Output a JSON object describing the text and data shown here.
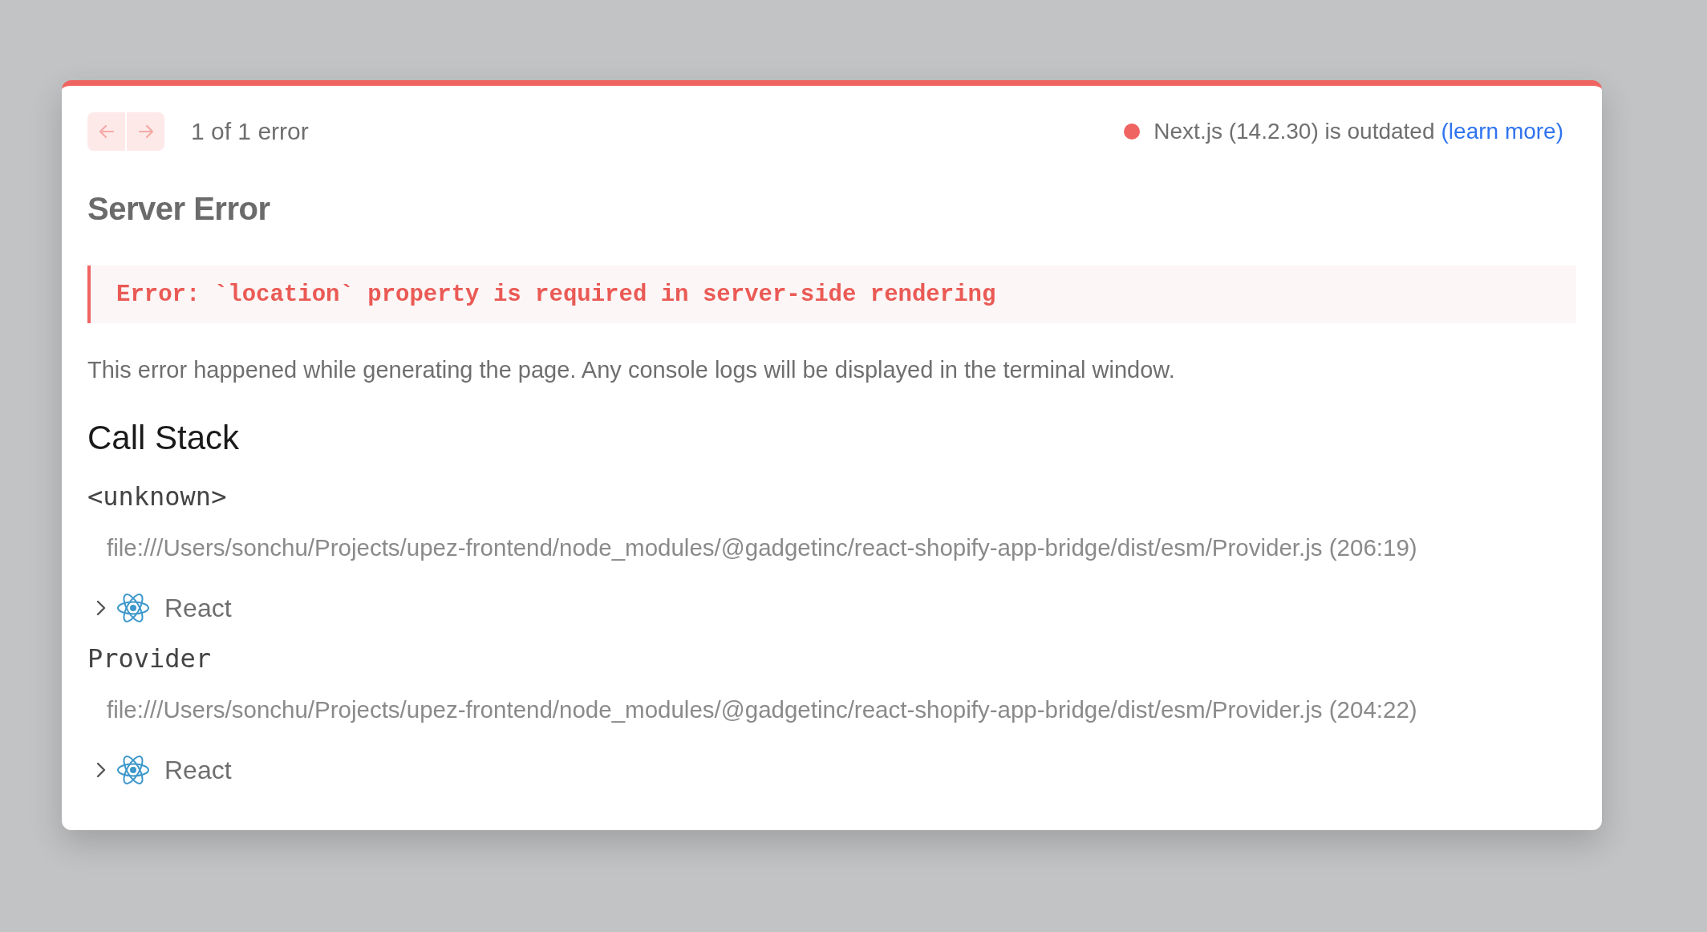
{
  "nav": {
    "buttons": [
      {
        "kind": "previous",
        "disabled": true
      },
      {
        "kind": "next",
        "disabled": true
      }
    ],
    "counter": "1 of 1 error"
  },
  "version": {
    "color": "#ef6461",
    "text": "Next.js (14.2.30) is outdated",
    "link": "(learn more)"
  },
  "title": "Server Error",
  "error_message": "Error: `location` property is required in server-side rendering",
  "description": "This error happened while generating the page. Any console logs will be displayed in the terminal window.",
  "call_stack": {
    "heading": "Call Stack",
    "frames": [
      {
        "name": "<unknown>",
        "file": "file:///Users/sonchu/Projects/upez-frontend/node_modules/@gadgetinc/react-shopify-app-bridge/dist/esm/Provider.js (206:19)",
        "group": {
          "label": "React",
          "expanded": false
        }
      },
      {
        "name": "Provider",
        "file": "file:///Users/sonchu/Projects/upez-frontend/node_modules/@gadgetinc/react-shopify-app-bridge/dist/esm/Provider.js (204:22)",
        "group": {
          "label": "React",
          "expanded": false
        }
      }
    ]
  }
}
